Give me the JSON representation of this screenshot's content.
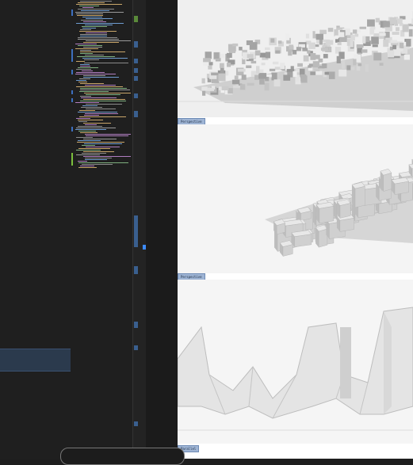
{
  "viewports": [
    {
      "label": ""
    },
    {
      "label": "Perspective"
    },
    {
      "label": "Perspective"
    },
    {
      "label": "Parallel"
    }
  ]
}
